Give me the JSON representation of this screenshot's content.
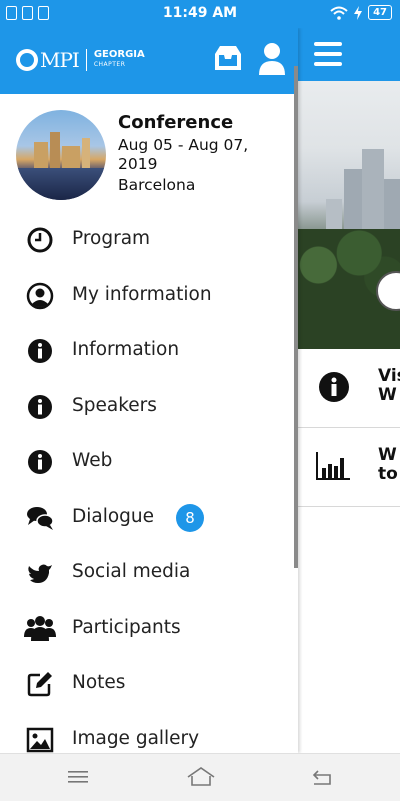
{
  "status_bar": {
    "time": "11:49 AM",
    "battery": "47"
  },
  "drawer": {
    "logo": {
      "brand": "MPI",
      "chapter_name": "GEORGIA",
      "chapter_sub": "CHAPTER"
    },
    "conference": {
      "title": "Conference",
      "dates": "Aug 05 - Aug 07, 2019",
      "city": "Barcelona"
    },
    "menu": [
      {
        "label": "Program",
        "icon": "clock-icon"
      },
      {
        "label": "My information",
        "icon": "user-circle-icon"
      },
      {
        "label": "Information",
        "icon": "info-icon"
      },
      {
        "label": "Speakers",
        "icon": "info-icon"
      },
      {
        "label": "Web",
        "icon": "info-icon"
      },
      {
        "label": "Dialogue",
        "icon": "chat-icon",
        "badge": "8"
      },
      {
        "label": "Social media",
        "icon": "twitter-icon"
      },
      {
        "label": "Participants",
        "icon": "people-icon"
      },
      {
        "label": "Notes",
        "icon": "edit-icon"
      },
      {
        "label": "Image gallery",
        "icon": "image-icon"
      }
    ]
  },
  "background": {
    "rows": [
      {
        "text_line1": "Vis",
        "text_line2": "W",
        "icon": "info-icon"
      },
      {
        "text_line1": "W",
        "text_line2": "to",
        "icon": "bar-chart-icon"
      }
    ]
  },
  "colors": {
    "primary": "#1e96e8",
    "badge": "#1e96e8"
  }
}
